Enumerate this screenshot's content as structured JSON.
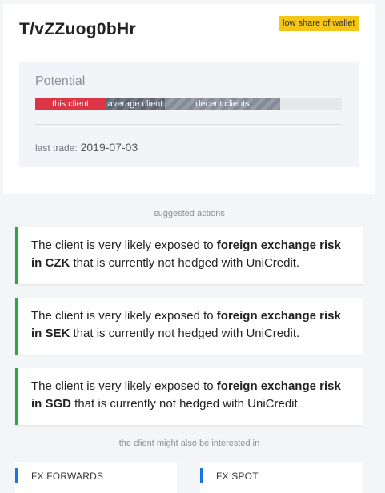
{
  "client": {
    "name": "T/vZZuog0bHr",
    "badge": "low share of wallet"
  },
  "potential": {
    "label": "Potential",
    "segments": [
      "this client",
      "average client",
      "decent clients"
    ],
    "last_trade_label": "last trade:",
    "last_trade_value": "2019-07-03"
  },
  "suggested": {
    "title": "suggested actions",
    "actions": [
      {
        "pre": "The client is very likely exposed to ",
        "bold": "foreign exchange risk in CZK",
        "post": " that is currently not hedged with UniCredit."
      },
      {
        "pre": "The client is very likely exposed to ",
        "bold": "foreign exchange risk in SEK",
        "post": " that is currently not hedged with UniCredit."
      },
      {
        "pre": "The client is very likely exposed to ",
        "bold": "foreign exchange risk in SGD",
        "post": " that is currently not hedged with UniCredit."
      }
    ]
  },
  "interests": {
    "title": "the client might also be interested in",
    "products": [
      "FX FORWARDS",
      "FX SPOT"
    ]
  },
  "colors": {
    "badge": "#f5c518",
    "this_client": "#dc3545",
    "action_accent": "#28a745",
    "product_accent": "#1a73e8"
  }
}
